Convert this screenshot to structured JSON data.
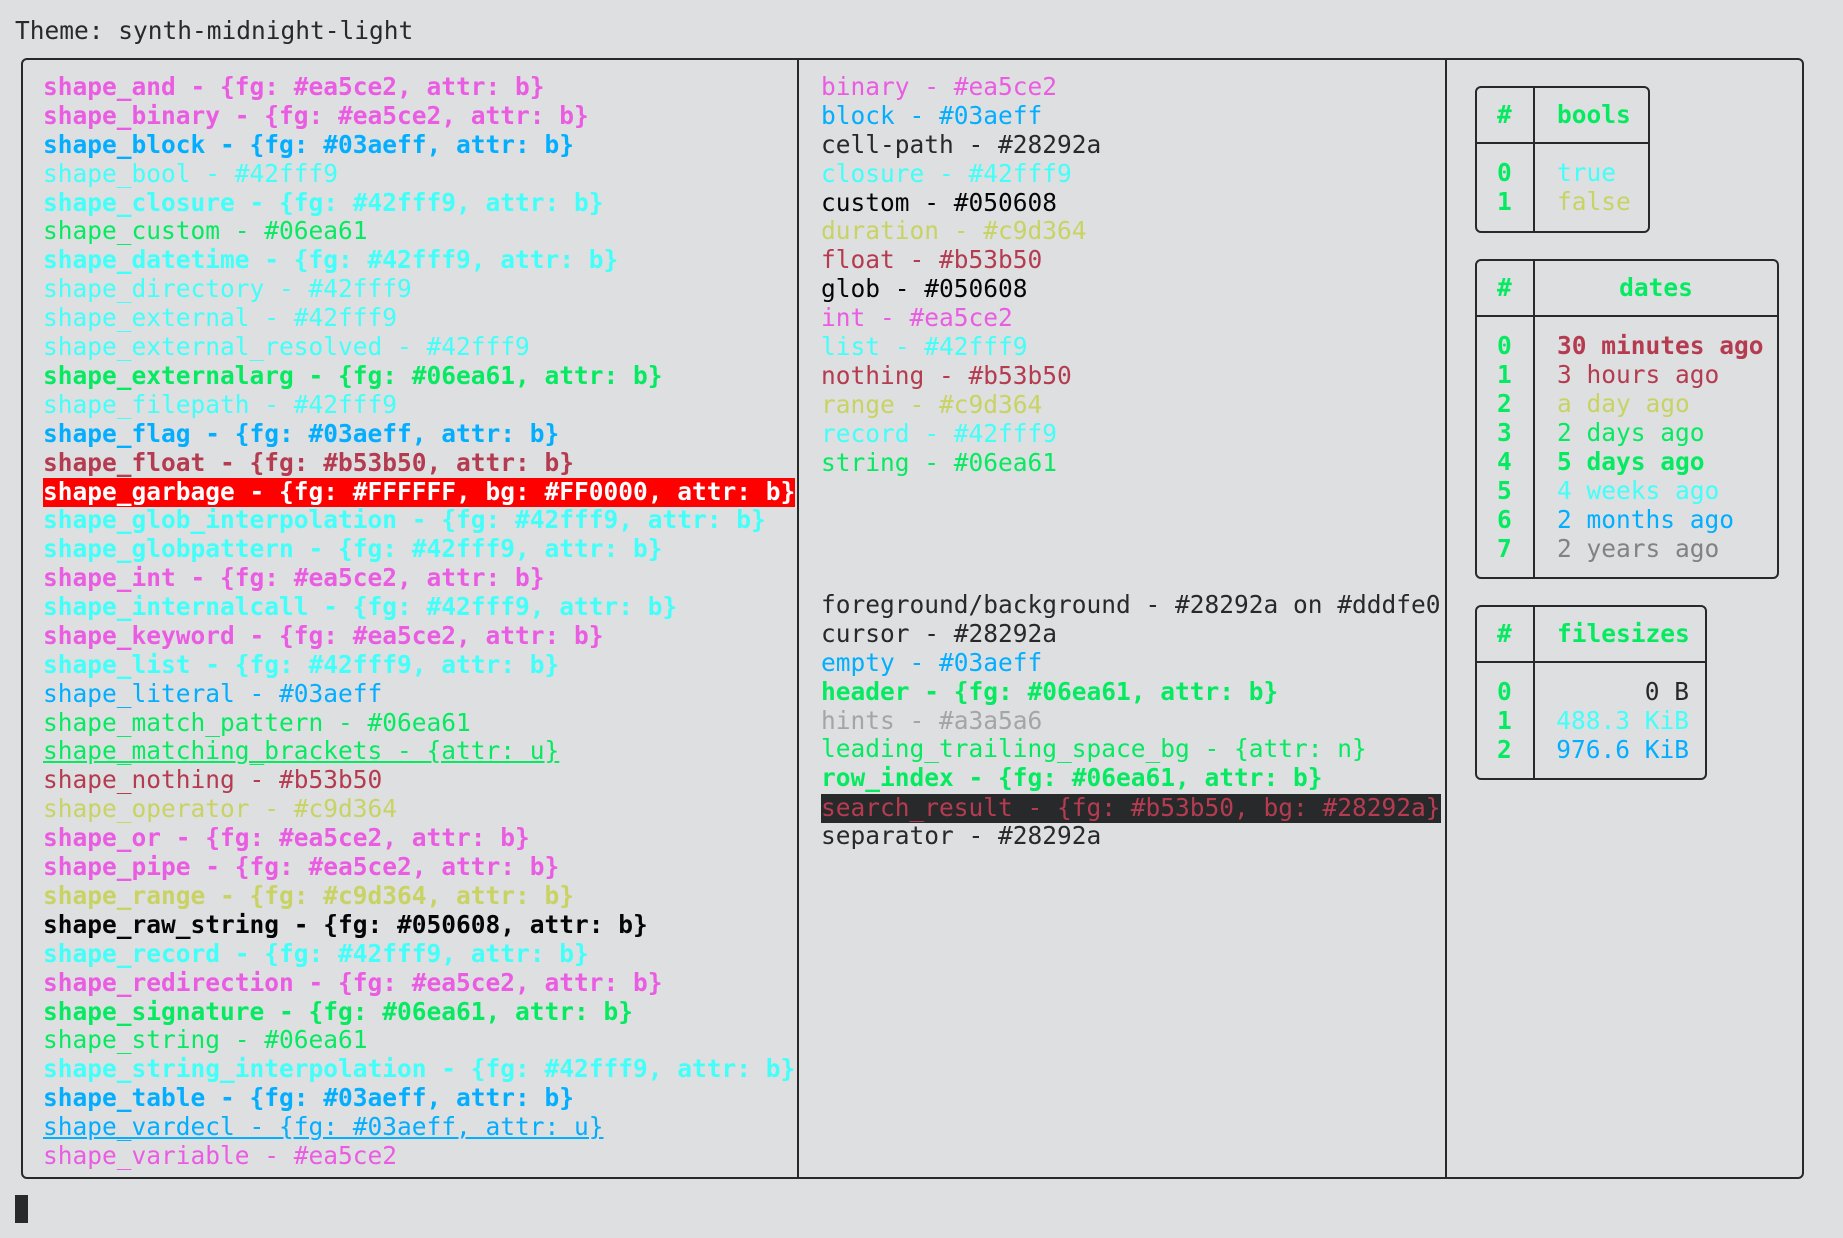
{
  "title": "Theme: synth-midnight-light",
  "left_entries": [
    {
      "text": "shape_and - {fg: #ea5ce2, attr: b}",
      "color": "#ea5ce2",
      "bold": true
    },
    {
      "text": "shape_binary - {fg: #ea5ce2, attr: b}",
      "color": "#ea5ce2",
      "bold": true
    },
    {
      "text": "shape_block - {fg: #03aeff, attr: b}",
      "color": "#03aeff",
      "bold": true
    },
    {
      "text": "shape_bool - #42fff9",
      "color": "#42fff9"
    },
    {
      "text": "shape_closure - {fg: #42fff9, attr: b}",
      "color": "#42fff9",
      "bold": true
    },
    {
      "text": "shape_custom - #06ea61",
      "color": "#06ea61"
    },
    {
      "text": "shape_datetime - {fg: #42fff9, attr: b}",
      "color": "#42fff9",
      "bold": true
    },
    {
      "text": "shape_directory - #42fff9",
      "color": "#42fff9"
    },
    {
      "text": "shape_external - #42fff9",
      "color": "#42fff9"
    },
    {
      "text": "shape_external_resolved - #42fff9",
      "color": "#42fff9"
    },
    {
      "text": "shape_externalarg - {fg: #06ea61, attr: b}",
      "color": "#06ea61",
      "bold": true
    },
    {
      "text": "shape_filepath - #42fff9",
      "color": "#42fff9"
    },
    {
      "text": "shape_flag - {fg: #03aeff, attr: b}",
      "color": "#03aeff",
      "bold": true
    },
    {
      "text": "shape_float - {fg: #b53b50, attr: b}",
      "color": "#b53b50",
      "bold": true
    },
    {
      "text": "shape_garbage - {fg: #FFFFFF, bg: #FF0000, attr: b}",
      "color": "#FFFFFF",
      "bg": "#FF0000",
      "bold": true
    },
    {
      "text": "shape_glob_interpolation - {fg: #42fff9, attr: b}",
      "color": "#42fff9",
      "bold": true
    },
    {
      "text": "shape_globpattern - {fg: #42fff9, attr: b}",
      "color": "#42fff9",
      "bold": true
    },
    {
      "text": "shape_int - {fg: #ea5ce2, attr: b}",
      "color": "#ea5ce2",
      "bold": true
    },
    {
      "text": "shape_internalcall - {fg: #42fff9, attr: b}",
      "color": "#42fff9",
      "bold": true
    },
    {
      "text": "shape_keyword - {fg: #ea5ce2, attr: b}",
      "color": "#ea5ce2",
      "bold": true
    },
    {
      "text": "shape_list - {fg: #42fff9, attr: b}",
      "color": "#42fff9",
      "bold": true
    },
    {
      "text": "shape_literal - #03aeff",
      "color": "#03aeff"
    },
    {
      "text": "shape_match_pattern - #06ea61",
      "color": "#06ea61"
    },
    {
      "text": "shape_matching_brackets - {attr: u}",
      "color": "#06ea61",
      "underline": true
    },
    {
      "text": "shape_nothing - #b53b50",
      "color": "#b53b50"
    },
    {
      "text": "shape_operator - #c9d364",
      "color": "#c9d364"
    },
    {
      "text": "shape_or - {fg: #ea5ce2, attr: b}",
      "color": "#ea5ce2",
      "bold": true
    },
    {
      "text": "shape_pipe - {fg: #ea5ce2, attr: b}",
      "color": "#ea5ce2",
      "bold": true
    },
    {
      "text": "shape_range - {fg: #c9d364, attr: b}",
      "color": "#c9d364",
      "bold": true
    },
    {
      "text": "shape_raw_string - {fg: #050608, attr: b}",
      "color": "#050608",
      "bold": true
    },
    {
      "text": "shape_record - {fg: #42fff9, attr: b}",
      "color": "#42fff9",
      "bold": true
    },
    {
      "text": "shape_redirection - {fg: #ea5ce2, attr: b}",
      "color": "#ea5ce2",
      "bold": true
    },
    {
      "text": "shape_signature - {fg: #06ea61, attr: b}",
      "color": "#06ea61",
      "bold": true
    },
    {
      "text": "shape_string - #06ea61",
      "color": "#06ea61"
    },
    {
      "text": "shape_string_interpolation - {fg: #42fff9, attr: b}",
      "color": "#42fff9",
      "bold": true
    },
    {
      "text": "shape_table - {fg: #03aeff, attr: b}",
      "color": "#03aeff",
      "bold": true
    },
    {
      "text": "shape_vardecl - {fg: #03aeff, attr: u}",
      "color": "#03aeff",
      "underline": true
    },
    {
      "text": "shape_variable - #ea5ce2",
      "color": "#ea5ce2"
    }
  ],
  "middle_entries_top": [
    {
      "text": "binary - #ea5ce2",
      "color": "#ea5ce2"
    },
    {
      "text": "block - #03aeff",
      "color": "#03aeff"
    },
    {
      "text": "cell-path - #28292a",
      "color": "#28292a"
    },
    {
      "text": "closure - #42fff9",
      "color": "#42fff9"
    },
    {
      "text": "custom - #050608",
      "color": "#050608"
    },
    {
      "text": "duration - #c9d364",
      "color": "#c9d364"
    },
    {
      "text": "float - #b53b50",
      "color": "#b53b50"
    },
    {
      "text": "glob - #050608",
      "color": "#050608"
    },
    {
      "text": "int - #ea5ce2",
      "color": "#ea5ce2"
    },
    {
      "text": "list - #42fff9",
      "color": "#42fff9"
    },
    {
      "text": "nothing - #b53b50",
      "color": "#b53b50"
    },
    {
      "text": "range - #c9d364",
      "color": "#c9d364"
    },
    {
      "text": "record - #42fff9",
      "color": "#42fff9"
    },
    {
      "text": "string - #06ea61",
      "color": "#06ea61"
    }
  ],
  "middle_entries_bottom": [
    {
      "text": "foreground/background - #28292a on #dddfe0",
      "color": "#28292a"
    },
    {
      "text": "cursor - #28292a",
      "color": "#28292a"
    },
    {
      "text": "empty - #03aeff",
      "color": "#03aeff"
    },
    {
      "text": "header - {fg: #06ea61, attr: b}",
      "color": "#06ea61",
      "bold": true
    },
    {
      "text": "hints - #a3a5a6",
      "color": "#a3a5a6"
    },
    {
      "text": "leading_trailing_space_bg - {attr: n}",
      "color": "#06ea61"
    },
    {
      "text": "row_index - {fg: #06ea61, attr: b}",
      "color": "#06ea61",
      "bold": true
    },
    {
      "text": "search_result - {fg: #b53b50, bg: #28292a}",
      "color": "#b53b50",
      "bg": "#28292a"
    },
    {
      "text": "separator - #28292a",
      "color": "#28292a"
    }
  ],
  "tables": {
    "bools": {
      "index_header": "#",
      "header": "bools",
      "rows": [
        {
          "idx": "0",
          "val": "true",
          "color": "#42fff9"
        },
        {
          "idx": "1",
          "val": "false",
          "color": "#c9d364"
        }
      ]
    },
    "dates": {
      "index_header": "#",
      "header": "dates",
      "rows": [
        {
          "idx": "0",
          "val": "30 minutes ago",
          "color": "#b53b50",
          "bold": true
        },
        {
          "idx": "1",
          "val": "3 hours ago",
          "color": "#b53b50"
        },
        {
          "idx": "2",
          "val": "a day ago",
          "color": "#c9d364"
        },
        {
          "idx": "3",
          "val": "2 days ago",
          "color": "#06ea61"
        },
        {
          "idx": "4",
          "val": "5 days ago",
          "color": "#06ea61",
          "bold": true
        },
        {
          "idx": "5",
          "val": "4 weeks ago",
          "color": "#42fff9"
        },
        {
          "idx": "6",
          "val": "2 months ago",
          "color": "#03aeff"
        },
        {
          "idx": "7",
          "val": "2 years ago",
          "color": "#808285"
        }
      ]
    },
    "filesizes": {
      "index_header": "#",
      "header": "filesizes",
      "rows": [
        {
          "idx": "0",
          "val": "0 B",
          "color": "#28292a"
        },
        {
          "idx": "1",
          "val": "488.3 KiB",
          "color": "#42fff9"
        },
        {
          "idx": "2",
          "val": "976.6 KiB",
          "color": "#03aeff"
        }
      ]
    }
  },
  "colors": {
    "background": "#dddfe0",
    "foreground": "#28292a",
    "header": "#06ea61",
    "row_index": "#06ea61"
  }
}
